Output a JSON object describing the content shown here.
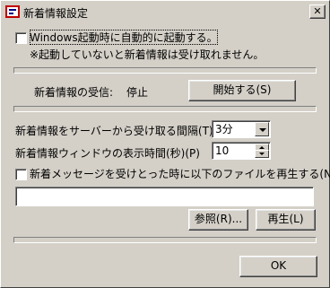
{
  "window": {
    "title": "新着情報設定",
    "close_glyph": "✕"
  },
  "startup": {
    "checkbox_label": "Windows起動時に自動的に起動する。",
    "checked": false,
    "note": "※起動していないと新着情報は受け取れません。"
  },
  "receive": {
    "label": "新着情報の受信:",
    "status": "停止",
    "start_button": "開始する(S)"
  },
  "interval": {
    "label": "新着情報をサーバーから受け取る間隔(T)",
    "value": "3分"
  },
  "display_time": {
    "label": "新着情報ウィンドウの表示時間(秒)(P)",
    "value": "10"
  },
  "sound": {
    "checkbox_label": "新着メッセージを受けとった時に以下のファイルを再生する(N)",
    "checked": false,
    "file_path": "",
    "browse_button": "参照(R)...",
    "play_button": "再生(L)"
  },
  "footer": {
    "ok_button": "OK"
  }
}
